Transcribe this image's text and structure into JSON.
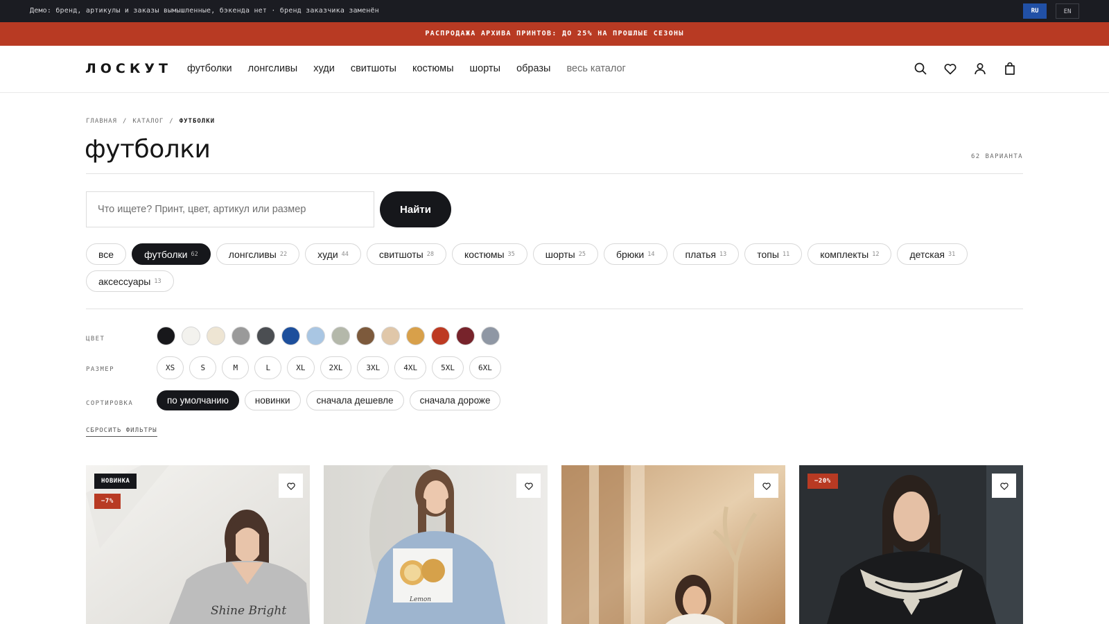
{
  "demo_bar": {
    "text": "Демо: бренд, артикулы и заказы вымышленные, бэкенда нет · бренд заказчика заменён",
    "languages": [
      "RU",
      "EN"
    ]
  },
  "promo_bar": {
    "text": "РАСПРОДАЖА АРХИВА ПРИНТОВ: ДО 25% НА ПРОШЛЫЕ СЕЗОНЫ"
  },
  "header": {
    "logo": "ЛОСКУТ",
    "nav": [
      "футболки",
      "лонгсливы",
      "худи",
      "свитшоты",
      "костюмы",
      "шорты",
      "образы",
      "весь каталог"
    ],
    "icons": [
      "search-icon",
      "heart-icon",
      "user-icon",
      "bag-icon"
    ]
  },
  "breadcrumb": [
    "ГЛАВНАЯ",
    "КАТАЛОГ",
    "ФУТБОЛКИ"
  ],
  "page": {
    "title": "футболки",
    "variants": "62 ВАРИАНТА"
  },
  "search": {
    "placeholder": "Что ищете? Принт, цвет, артикул или размер",
    "value": "",
    "button": "Найти"
  },
  "categories": [
    {
      "label": "все",
      "count": "",
      "active": false
    },
    {
      "label": "футболки",
      "count": "62",
      "active": true
    },
    {
      "label": "лонгсливы",
      "count": "22",
      "active": false
    },
    {
      "label": "худи",
      "count": "44",
      "active": false
    },
    {
      "label": "свитшоты",
      "count": "28",
      "active": false
    },
    {
      "label": "костюмы",
      "count": "35",
      "active": false
    },
    {
      "label": "шорты",
      "count": "25",
      "active": false
    },
    {
      "label": "брюки",
      "count": "14",
      "active": false
    },
    {
      "label": "платья",
      "count": "13",
      "active": false
    },
    {
      "label": "топы",
      "count": "11",
      "active": false
    },
    {
      "label": "комплекты",
      "count": "12",
      "active": false
    },
    {
      "label": "детская",
      "count": "31",
      "active": false
    },
    {
      "label": "аксессуары",
      "count": "13",
      "active": false
    }
  ],
  "filters": {
    "color_label": "ЦВЕТ",
    "colors": [
      "#18181b",
      "#f3f2ee",
      "#eee5d3",
      "#9a9a9a",
      "#4b4e52",
      "#1d4f9c",
      "#a9c6e3",
      "#b4b8aa",
      "#7d5a3c",
      "#e0c7a9",
      "#d8a04a",
      "#bd3a22",
      "#77232b",
      "#8f97a4"
    ],
    "size_label": "РАЗМЕР",
    "sizes": [
      "XS",
      "S",
      "M",
      "L",
      "XL",
      "2XL",
      "3XL",
      "4XL",
      "5XL",
      "6XL"
    ],
    "sort_label": "СОРТИРОВКА",
    "sorts": [
      {
        "label": "по умолчанию",
        "active": true
      },
      {
        "label": "новинки",
        "active": false
      },
      {
        "label": "сначала дешевле",
        "active": false
      },
      {
        "label": "сначала дороже",
        "active": false
      }
    ],
    "reset": "СБРОСИТЬ ФИЛЬТРЫ"
  },
  "products": [
    {
      "badges": [
        {
          "text": "НОВИНКА",
          "kind": "new"
        },
        {
          "text": "−7%",
          "kind": "sale"
        }
      ],
      "photo": "shine-bright"
    },
    {
      "badges": [],
      "photo": "lemon"
    },
    {
      "badges": [],
      "photo": "warm-room"
    },
    {
      "badges": [
        {
          "text": "−20%",
          "kind": "sale"
        }
      ],
      "photo": "embroidery"
    }
  ],
  "photo_text": {
    "shine": "Shine Bright",
    "lemon": "Lemon"
  }
}
